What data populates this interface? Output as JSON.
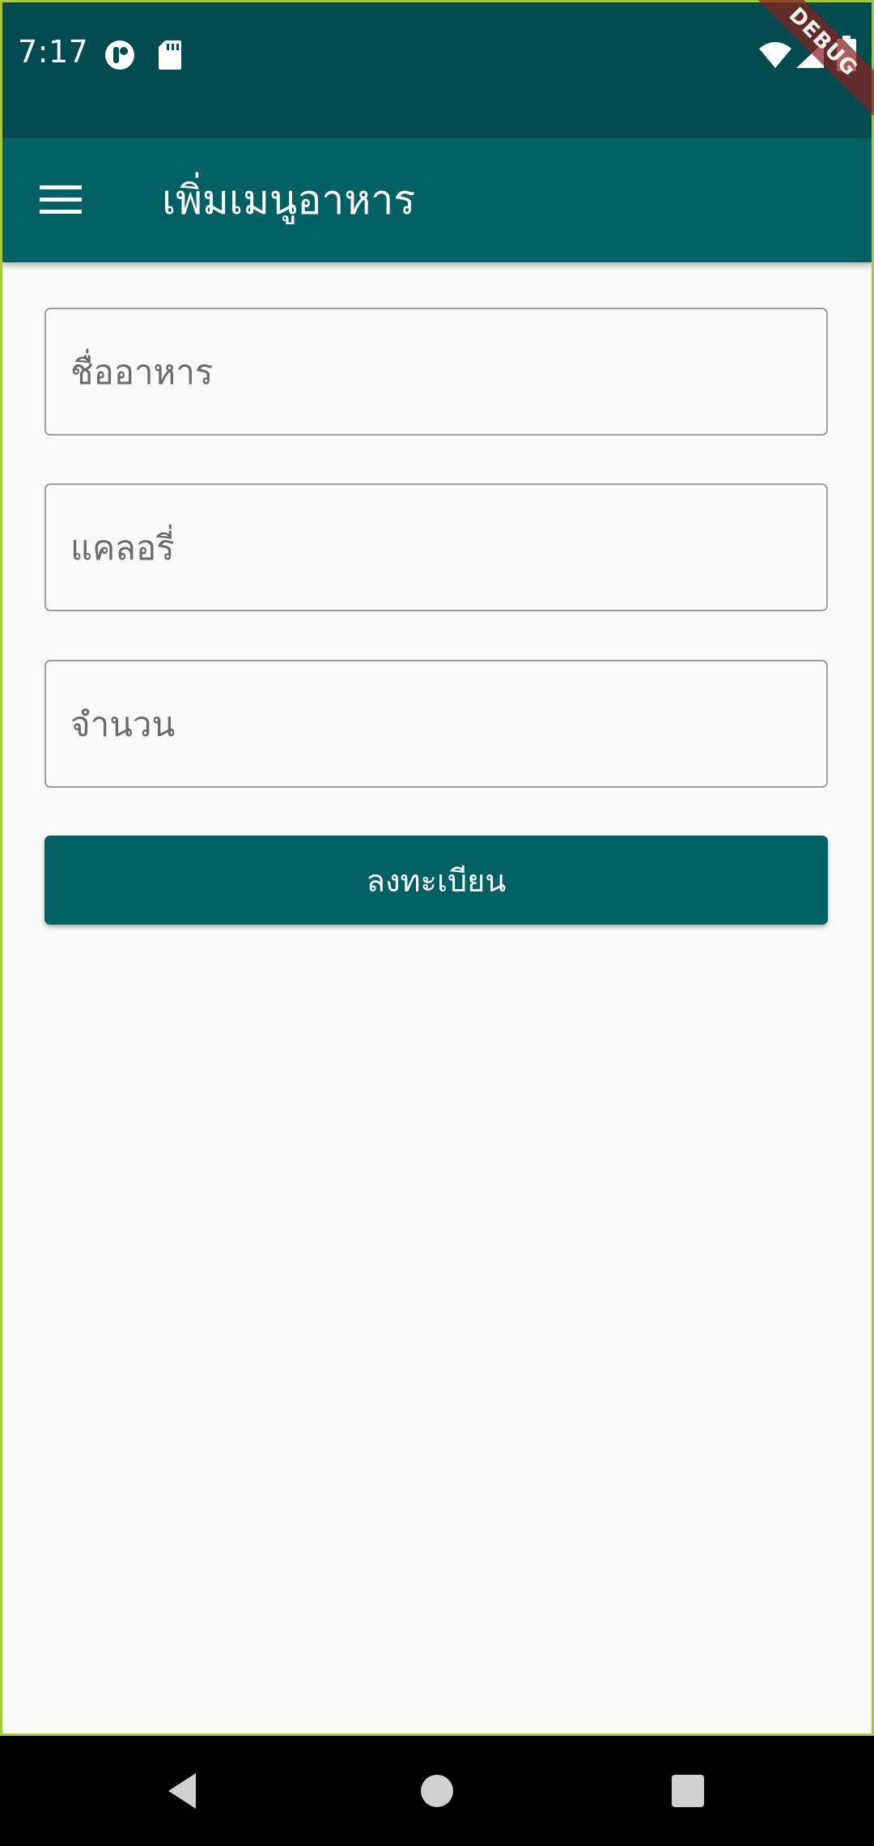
{
  "status_bar": {
    "time": "7:17",
    "left_icons": [
      "notification-app-icon",
      "sd-card-icon"
    ],
    "right_icons": [
      "wifi-icon",
      "signal-icon",
      "battery-icon"
    ],
    "debug_banner": "DEBUG",
    "background_color": "#004b4f"
  },
  "app_bar": {
    "title": "เพิ่มเมนูอาหาร",
    "menu_icon": "menu-icon",
    "background_color": "#006064"
  },
  "form": {
    "fields": [
      {
        "name": "food-name",
        "placeholder": "ชื่ออาหาร",
        "value": ""
      },
      {
        "name": "calories",
        "placeholder": "แคลอรี่",
        "value": ""
      },
      {
        "name": "quantity",
        "placeholder": "จำนวน",
        "value": ""
      }
    ],
    "submit_label": "ลงทะเบียน",
    "accent_color": "#006064"
  },
  "nav_bar": {
    "buttons": [
      "back-icon",
      "home-icon",
      "recents-icon"
    ]
  }
}
